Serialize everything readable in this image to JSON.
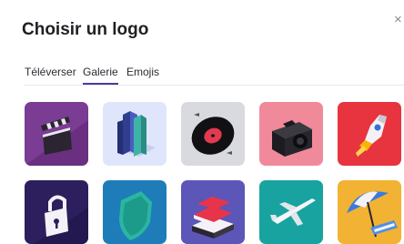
{
  "dialog": {
    "title": "Choisir un logo",
    "close_icon": "close-icon",
    "close_glyph": "×"
  },
  "tabs": [
    {
      "label": "Téléverser",
      "active": false
    },
    {
      "label": "Galerie",
      "active": true
    },
    {
      "label": "Emojis",
      "active": false
    }
  ],
  "colors": {
    "accent": "#4a3aa0",
    "tile_backgrounds": [
      "#7b3c93",
      "#dfe6fb",
      "#d8dadf",
      "#f08a9a",
      "#e8343e",
      "#2d1f5e",
      "#1e7db8",
      "#5b56b8",
      "#18a3a0",
      "#f2b233"
    ]
  },
  "gallery": {
    "row1": [
      {
        "icon": "clapperboard-icon"
      },
      {
        "icon": "books-icon"
      },
      {
        "icon": "vinyl-record-icon"
      },
      {
        "icon": "camera-icon"
      },
      {
        "icon": "rocket-icon"
      }
    ],
    "row2": [
      {
        "icon": "padlock-icon"
      },
      {
        "icon": "shield-icon"
      },
      {
        "icon": "book-stack-icon"
      },
      {
        "icon": "airplane-icon"
      },
      {
        "icon": "beach-umbrella-icon"
      }
    ]
  }
}
